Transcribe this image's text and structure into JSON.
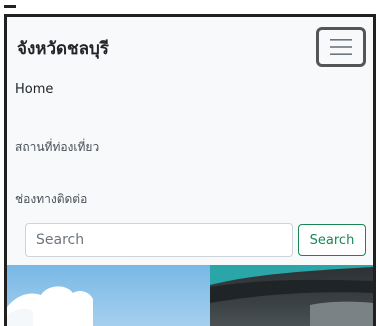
{
  "navbar": {
    "brand": "จังหวัดชลบุรี",
    "toggler_icon": "hamburger-menu-icon",
    "links": [
      {
        "label": "Home"
      },
      {
        "label": "สถานที่ท่องเที่ยว"
      },
      {
        "label": "ช่องทางติดต่อ"
      }
    ]
  },
  "search": {
    "placeholder": "Search",
    "button_label": "Search"
  },
  "colors": {
    "navbar_bg": "#f8f9fa",
    "search_button": "#198754"
  }
}
